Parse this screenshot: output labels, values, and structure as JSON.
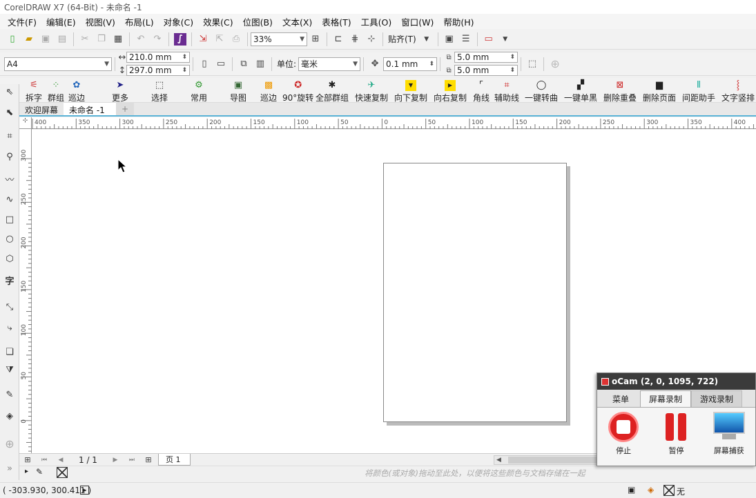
{
  "window": {
    "title": "CorelDRAW X7 (64-Bit) - 未命名 -1"
  },
  "menu": [
    "文件(F)",
    "编辑(E)",
    "视图(V)",
    "布局(L)",
    "对象(C)",
    "效果(C)",
    "位图(B)",
    "文本(X)",
    "表格(T)",
    "工具(O)",
    "窗口(W)",
    "帮助(H)"
  ],
  "toolbar1": {
    "zoom": "33%",
    "snap_label": "贴齐(T)"
  },
  "toolbar2": {
    "page_size": "A4",
    "width": "210.0 mm",
    "height": "297.0 mm",
    "units_label": "单位:",
    "units_value": "毫米",
    "nudge": "0.1 mm",
    "dup_x": "5.0 mm",
    "dup_y": "5.0 mm"
  },
  "plugin_tools": [
    "拆字",
    "群组",
    "巡边",
    "更多",
    "选择",
    "常用",
    "导图",
    "巡边",
    "90°旋转",
    "全部群组",
    "快速复制",
    "向下复制",
    "向右复制",
    "角线",
    "辅助线",
    "一键转曲",
    "一键单黑",
    "删除重叠",
    "删除页面",
    "间距助手",
    "文字竖排"
  ],
  "toolbox_text": {
    "text_tool": "字"
  },
  "tabs": [
    "欢迎屏幕",
    "未命名 -1"
  ],
  "hruler_labels": [
    "400",
    "350",
    "300",
    "250",
    "200",
    "150",
    "100",
    "50",
    "0",
    "50",
    "100",
    "150",
    "200",
    "250",
    "300",
    "350",
    "400"
  ],
  "vruler_labels": [
    "300",
    "250",
    "200",
    "150",
    "100",
    "50",
    "0"
  ],
  "pagebar": {
    "counter": "1 / 1",
    "page_tab": "页 1"
  },
  "palette": {
    "hint": "将颜色(或对象)拖动至此处，以便将这些颜色与文档存储在一起"
  },
  "status": {
    "coords": "( -303.930, 300.411 )",
    "fill_none": "无"
  },
  "ocam": {
    "title": "oCam (2, 0, 1095, 722)",
    "tabs": [
      "菜单",
      "屏幕录制",
      "游戏录制"
    ],
    "buttons": [
      "停止",
      "暂停",
      "屏幕捕获"
    ]
  }
}
